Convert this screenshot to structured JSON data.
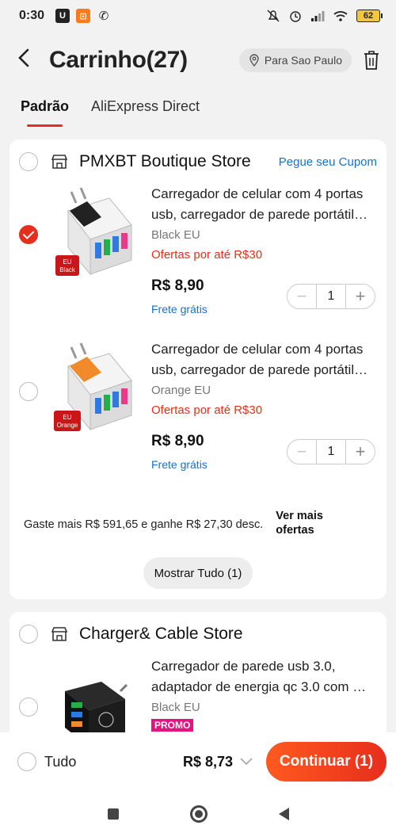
{
  "status": {
    "time": "0:30",
    "battery": "62"
  },
  "header": {
    "title": "Carrinho(27)",
    "location": "Para Sao Paulo"
  },
  "tabs": [
    {
      "label": "Padrão",
      "active": true
    },
    {
      "label": "AliExpress Direct",
      "active": false
    }
  ],
  "stores": [
    {
      "name": "PMXBT Boutique Store",
      "coupon": "Pegue seu Cupom",
      "items": [
        {
          "title": "Carregador de celular com 4 portas usb, carregador de parede portátil…",
          "variant": "Black EU",
          "offer": "Ofertas por até R$30",
          "price": "R$ 8,90",
          "shipping": "Frete grátis",
          "qty": "1",
          "checked": true,
          "badge": [
            "EU",
            "Black"
          ],
          "accent": "#222222"
        },
        {
          "title": "Carregador de celular com 4 portas usb, carregador de parede portátil…",
          "variant": "Orange EU",
          "offer": "Ofertas por até R$30",
          "price": "R$ 8,90",
          "shipping": "Frete grátis",
          "qty": "1",
          "checked": false,
          "badge": [
            "EU",
            "Orange"
          ],
          "accent": "#f08a2a"
        }
      ],
      "promo_text": "Gaste mais R$ 591,65 e ganhe R$ 27,30 desc.",
      "promo_link": [
        "Ver mais",
        "ofertas"
      ],
      "show_all": "Mostrar Tudo (1)"
    },
    {
      "name": "Charger& Cable Store",
      "items": [
        {
          "title": "Carregador de parede usb 3.0, adaptador de energia qc 3.0 com …",
          "variant": "Black EU",
          "promo_badge": "PROMO"
        }
      ]
    }
  ],
  "bottom": {
    "all_label": "Tudo",
    "total": "R$ 8,73",
    "continue": "Continuar (1)"
  },
  "colors": {
    "accent": "#e62e1c",
    "link": "#1a6fd1",
    "promo": "#e6127f"
  }
}
